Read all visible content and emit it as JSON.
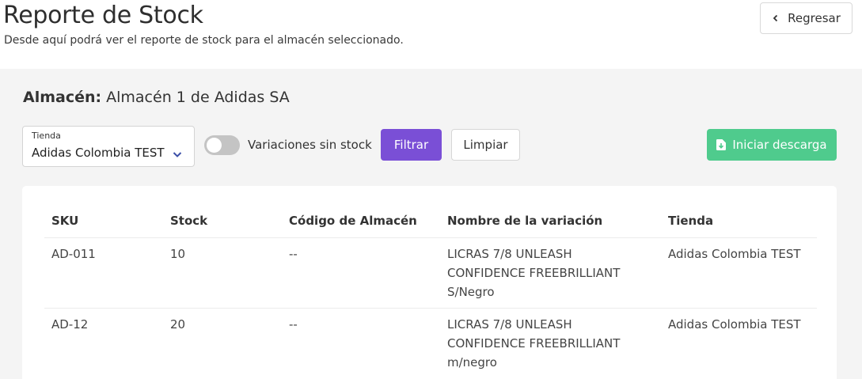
{
  "header": {
    "title": "Reporte de Stock",
    "subtitle": "Desde aquí podrá ver el reporte de stock para el almacén seleccionado.",
    "back_label": "Regresar"
  },
  "almacen": {
    "label": "Almacén:",
    "value": "Almacén 1 de Adidas SA"
  },
  "filters": {
    "tienda_label": "Tienda",
    "tienda_value": "Adidas Colombia TEST",
    "toggle_label": "Variaciones sin stock",
    "toggle_on": false,
    "filtrar_label": "Filtrar",
    "limpiar_label": "Limpiar",
    "descarga_label": "Iniciar descarga"
  },
  "table": {
    "columns": [
      "SKU",
      "Stock",
      "Código de Almacén",
      "Nombre de la variación",
      "Tienda"
    ],
    "rows": [
      {
        "sku": "AD-011",
        "stock": "10",
        "codigo": "--",
        "nombre": [
          "LICRAS 7/8 UNLEASH",
          "CONFIDENCE FREEBRILLIANT",
          "S/Negro"
        ],
        "tienda": "Adidas Colombia TEST"
      },
      {
        "sku": "AD-12",
        "stock": "20",
        "codigo": "--",
        "nombre": [
          "LICRAS 7/8 UNLEASH",
          "CONFIDENCE FREEBRILLIANT",
          "m/negro"
        ],
        "tienda": "Adidas Colombia TEST"
      }
    ]
  },
  "colors": {
    "primary": "#7a4fd6",
    "success": "#4fcb8d",
    "background": "#f4f4f4"
  }
}
